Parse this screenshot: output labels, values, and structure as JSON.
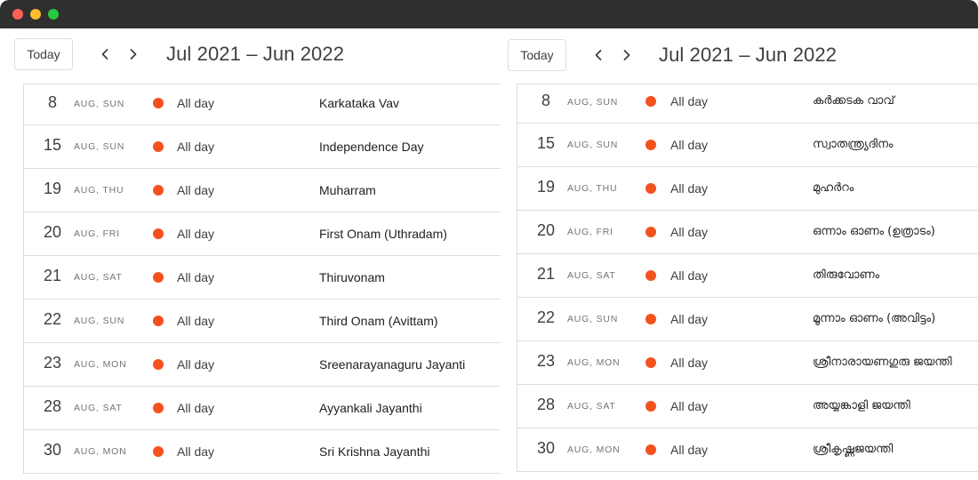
{
  "colors": {
    "titlebar": "#2f2f30",
    "event_dot": "#f4511e",
    "divider": "#dadce0",
    "text_primary": "#3c4043",
    "text_secondary": "#70757a"
  },
  "window": {
    "controls": [
      "close",
      "minimize",
      "zoom"
    ]
  },
  "left": {
    "toolbar": {
      "today_label": "Today",
      "prev_icon": "chevron-left-icon",
      "next_icon": "chevron-right-icon",
      "date_range": "Jul 2021 – Jun 2022"
    },
    "events": [
      {
        "day": "8",
        "month_weekday": "AUG, SUN",
        "time": "All day",
        "title": "Karkataka Vav"
      },
      {
        "day": "15",
        "month_weekday": "AUG, SUN",
        "time": "All day",
        "title": "Independence Day"
      },
      {
        "day": "19",
        "month_weekday": "AUG, THU",
        "time": "All day",
        "title": "Muharram"
      },
      {
        "day": "20",
        "month_weekday": "AUG, FRI",
        "time": "All day",
        "title": "First Onam (Uthradam)"
      },
      {
        "day": "21",
        "month_weekday": "AUG, SAT",
        "time": "All day",
        "title": "Thiruvonam"
      },
      {
        "day": "22",
        "month_weekday": "AUG, SUN",
        "time": "All day",
        "title": "Third Onam (Avittam)"
      },
      {
        "day": "23",
        "month_weekday": "AUG, MON",
        "time": "All day",
        "title": "Sreenarayanaguru Jayanti"
      },
      {
        "day": "28",
        "month_weekday": "AUG, SAT",
        "time": "All day",
        "title": "Ayyankali Jayanthi"
      },
      {
        "day": "30",
        "month_weekday": "AUG, MON",
        "time": "All day",
        "title": "Sri Krishna Jayanthi"
      }
    ]
  },
  "right": {
    "toolbar": {
      "today_label": "Today",
      "prev_icon": "chevron-left-icon",
      "next_icon": "chevron-right-icon",
      "date_range": "Jul 2021 – Jun 2022"
    },
    "events": [
      {
        "day": "8",
        "month_weekday": "AUG, SUN",
        "time": "All day",
        "title": "കർക്കടക വാവ്"
      },
      {
        "day": "15",
        "month_weekday": "AUG, SUN",
        "time": "All day",
        "title": "സ്വാതന്ത്ര്യദിനം"
      },
      {
        "day": "19",
        "month_weekday": "AUG, THU",
        "time": "All day",
        "title": "മുഹർറം"
      },
      {
        "day": "20",
        "month_weekday": "AUG, FRI",
        "time": "All day",
        "title": "ഒന്നാം ഓണം (ഉത്രാടം)"
      },
      {
        "day": "21",
        "month_weekday": "AUG, SAT",
        "time": "All day",
        "title": "തിരുവോണം"
      },
      {
        "day": "22",
        "month_weekday": "AUG, SUN",
        "time": "All day",
        "title": "മൂന്നാം ഓണം (അവിട്ടം)"
      },
      {
        "day": "23",
        "month_weekday": "AUG, MON",
        "time": "All day",
        "title": "ശ്രീനാരായണഗുരു ജയന്തി"
      },
      {
        "day": "28",
        "month_weekday": "AUG, SAT",
        "time": "All day",
        "title": "അയ്യങ്കാളി ജയന്തി"
      },
      {
        "day": "30",
        "month_weekday": "AUG, MON",
        "time": "All day",
        "title": "ശ്രീകൃഷ്ണജയന്തി"
      }
    ]
  }
}
